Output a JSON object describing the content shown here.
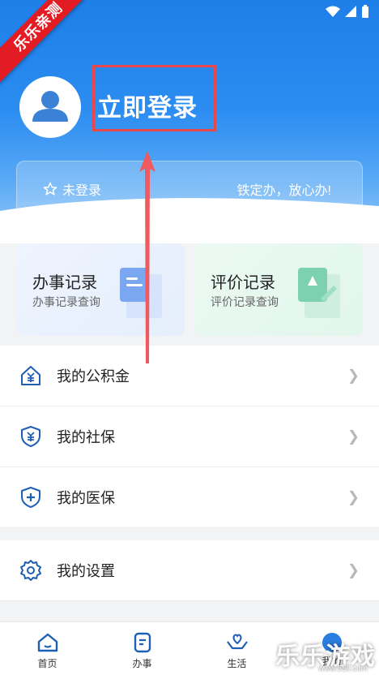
{
  "ribbon": {
    "text": "乐乐亲测"
  },
  "profile": {
    "login_text": "立即登录"
  },
  "status_card": {
    "status_text": "未登录",
    "slogan": "铁定办，放心办!"
  },
  "quick_cards": [
    {
      "title": "办事记录",
      "subtitle": "办事记录查询"
    },
    {
      "title": "评价记录",
      "subtitle": "评价记录查询"
    }
  ],
  "menu": [
    {
      "label": "我的公积金",
      "icon": "house-yuan-icon"
    },
    {
      "label": "我的社保",
      "icon": "shield-yuan-icon"
    },
    {
      "label": "我的医保",
      "icon": "shield-cross-icon"
    }
  ],
  "menu2": [
    {
      "label": "我的设置",
      "icon": "gear-icon"
    }
  ],
  "tabs": [
    {
      "label": "首页",
      "icon": "home-icon"
    },
    {
      "label": "办事",
      "icon": "document-icon"
    },
    {
      "label": "生活",
      "icon": "heart-hands-icon"
    },
    {
      "label": "我的",
      "icon": "user-icon"
    }
  ],
  "watermark": {
    "text": "乐乐游戏",
    "sub": "www.55ll.com"
  },
  "colors": {
    "primary": "#1e7fe8",
    "highlight": "#e8484c",
    "ribbon": "#e31b23"
  }
}
